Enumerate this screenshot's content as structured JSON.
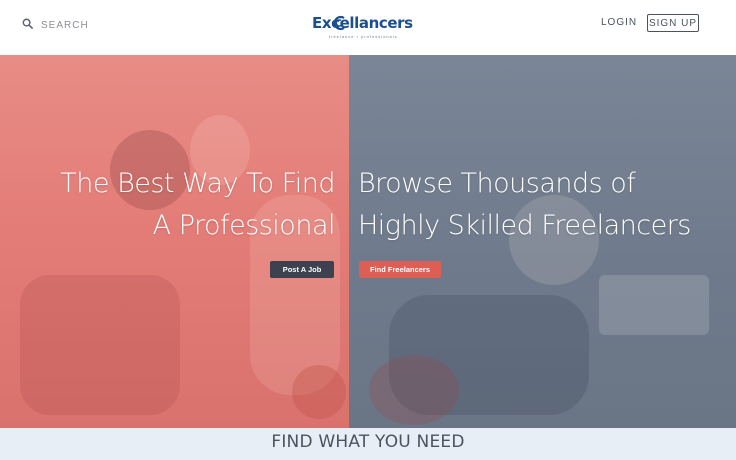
{
  "header": {
    "search_label": "SEARCH",
    "search_icon": "search-icon",
    "logo": {
      "brand": "Excellancers",
      "tagline": "freelance • professionals"
    },
    "login_label": "LOGIN",
    "signup_label": "SIGN UP"
  },
  "hero": {
    "left": {
      "title_line1": "The Best Way To Find",
      "title_line2": "A Professional",
      "button_label": "Post A Job"
    },
    "right": {
      "title_line1": "Browse Thousands of",
      "title_line2": "Highly Skilled Freelancers",
      "button_label": "Find Freelancers"
    }
  },
  "section": {
    "title": "FIND WHAT YOU NEED"
  },
  "colors": {
    "left_overlay": "#e37b76",
    "right_overlay": "#6f7b8c",
    "post_button": "#3d4150",
    "find_button": "#dd5e55",
    "brand_blue": "#1b4f8f",
    "band": "#e8eef6"
  }
}
